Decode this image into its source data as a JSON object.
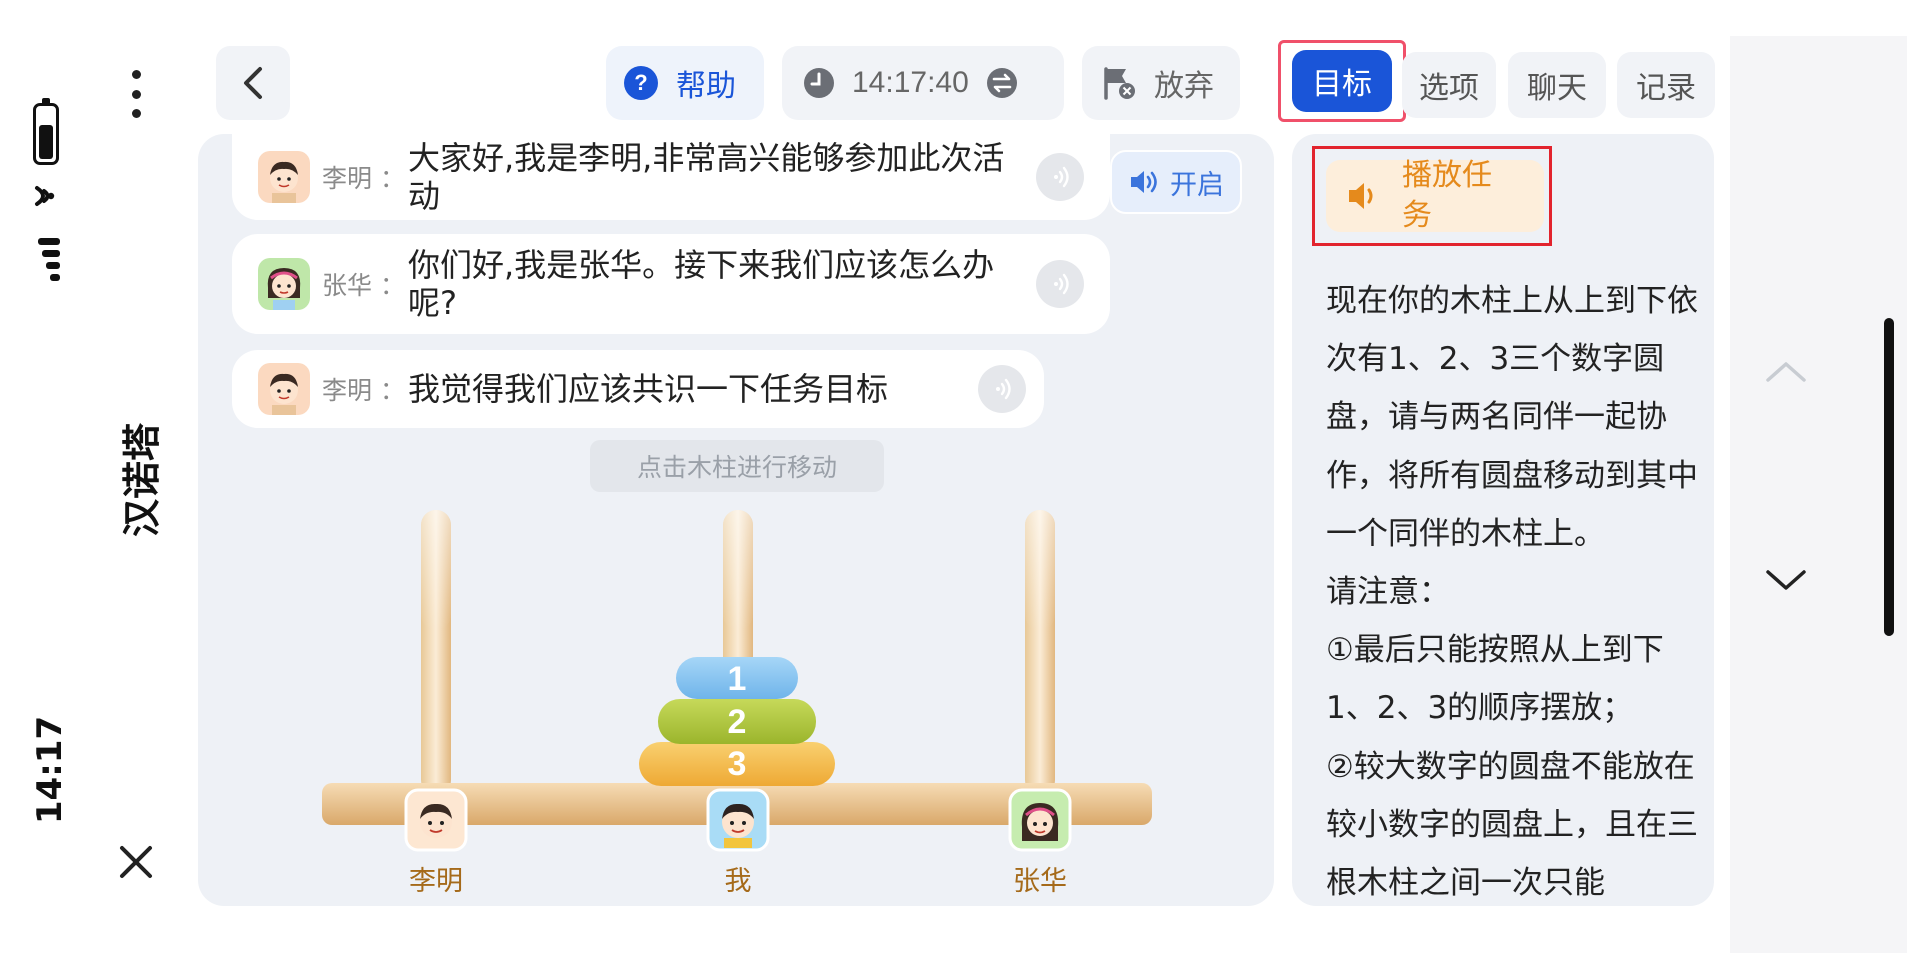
{
  "status_bar": {
    "time": "14:17",
    "battery_level": 0.65,
    "icons": [
      "battery-icon",
      "wifi-icon",
      "signal-icon"
    ]
  },
  "side": {
    "title": "汉诺塔",
    "more_icon": "more-vertical-icon",
    "close_icon": "close-icon"
  },
  "toolbar": {
    "back_icon": "chevron-left-icon",
    "help_label": "帮助",
    "timer": "14:17:40",
    "giveup_label": "放弃"
  },
  "tabs": [
    {
      "label": "目标",
      "active": true
    },
    {
      "label": "选项",
      "active": false
    },
    {
      "label": "聊天",
      "active": false
    },
    {
      "label": "记录",
      "active": false
    }
  ],
  "chat": {
    "messages": [
      {
        "name": "李明",
        "sep": "：",
        "text": "大家好,我是李明,非常高兴能够参加此次活动"
      },
      {
        "name": "张华",
        "sep": "：",
        "text": "你们好,我是张华。接下来我们应该怎么办呢?"
      },
      {
        "name": "李明",
        "sep": "：",
        "text": "我觉得我们应该共识一下任务目标"
      }
    ],
    "voice_toggle_label": "开启"
  },
  "game": {
    "hint": "点击木柱进行移动",
    "disks": [
      "1",
      "2",
      "3"
    ],
    "players": [
      "李明",
      "我",
      "张华"
    ]
  },
  "task": {
    "play_label": "播放任务",
    "description": "现在你的木柱上从上到下依次有1、2、3三个数字圆盘，请与两名同伴一起协作，将所有圆盘移动到其中一个同伴的木柱上。",
    "note_title": "请注意：",
    "note_1": "①最后只能按照从上到下1、2、3的顺序摆放；",
    "note_2": "②较大数字的圆盘不能放在较小数字的圆盘上，且在三根木柱之间一次只能"
  },
  "colors": {
    "accent": "#1a55d8",
    "highlight_frame": "#f0506a",
    "task_frame": "#e2232d",
    "play_orange": "#e58a1c",
    "disk_1": "#7fc0ef",
    "disk_2": "#a9c23a",
    "disk_3": "#f2b540",
    "wood": "#e9c08c"
  }
}
